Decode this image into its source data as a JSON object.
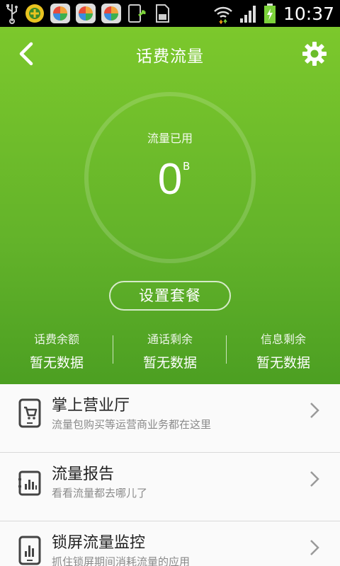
{
  "status_bar": {
    "time": "10:37",
    "icons": [
      "usb-icon",
      "app-icon",
      "app-icon",
      "app-icon",
      "app-icon",
      "transfer-icon",
      "sd-card-icon",
      "wifi-icon",
      "signal-icon",
      "battery-charging-icon"
    ]
  },
  "header": {
    "title": "话费流量",
    "usage_label": "流量已用",
    "usage_value": "0",
    "usage_unit": "B",
    "plan_button": "设置套餐"
  },
  "stats": [
    {
      "label": "话费余额",
      "value": "暂无数据"
    },
    {
      "label": "通话剩余",
      "value": "暂无数据"
    },
    {
      "label": "信息剩余",
      "value": "暂无数据"
    }
  ],
  "list": [
    {
      "title": "掌上营业厅",
      "subtitle": "流量包购买等运营商业务都在这里",
      "icon": "cart-phone-icon"
    },
    {
      "title": "流量报告",
      "subtitle": "看看流量都去哪儿了",
      "icon": "report-chart-icon"
    },
    {
      "title": "锁屏流量监控",
      "subtitle": "抓住锁屏期间消耗流量的应用",
      "icon": "lock-chart-icon"
    }
  ],
  "colors": {
    "header_green": "#6bbd2a",
    "header_green_dark": "#4c9f22",
    "list_background": "#fafafa"
  }
}
